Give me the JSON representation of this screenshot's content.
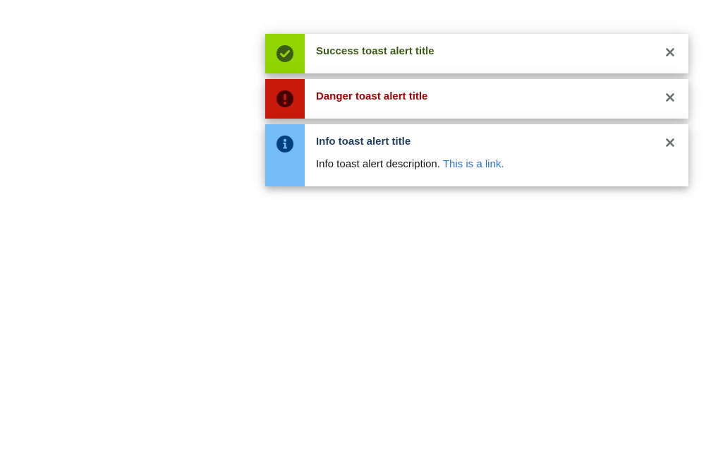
{
  "toasts": [
    {
      "variant": "success",
      "icon": "check-circle-icon",
      "title": "Success toast alert title",
      "accent_color": "#92d400",
      "title_color": "#3b5c14"
    },
    {
      "variant": "danger",
      "icon": "exclamation-circle-icon",
      "title": "Danger toast alert title",
      "accent_color": "#c9190b",
      "title_color": "#a30000"
    },
    {
      "variant": "info",
      "icon": "info-circle-icon",
      "title": "Info toast alert title",
      "description": "Info toast alert description. ",
      "link_text": "This is a link.",
      "accent_color": "#73bcf7",
      "title_color": "#1f4063"
    }
  ],
  "close_icon": "close-icon"
}
